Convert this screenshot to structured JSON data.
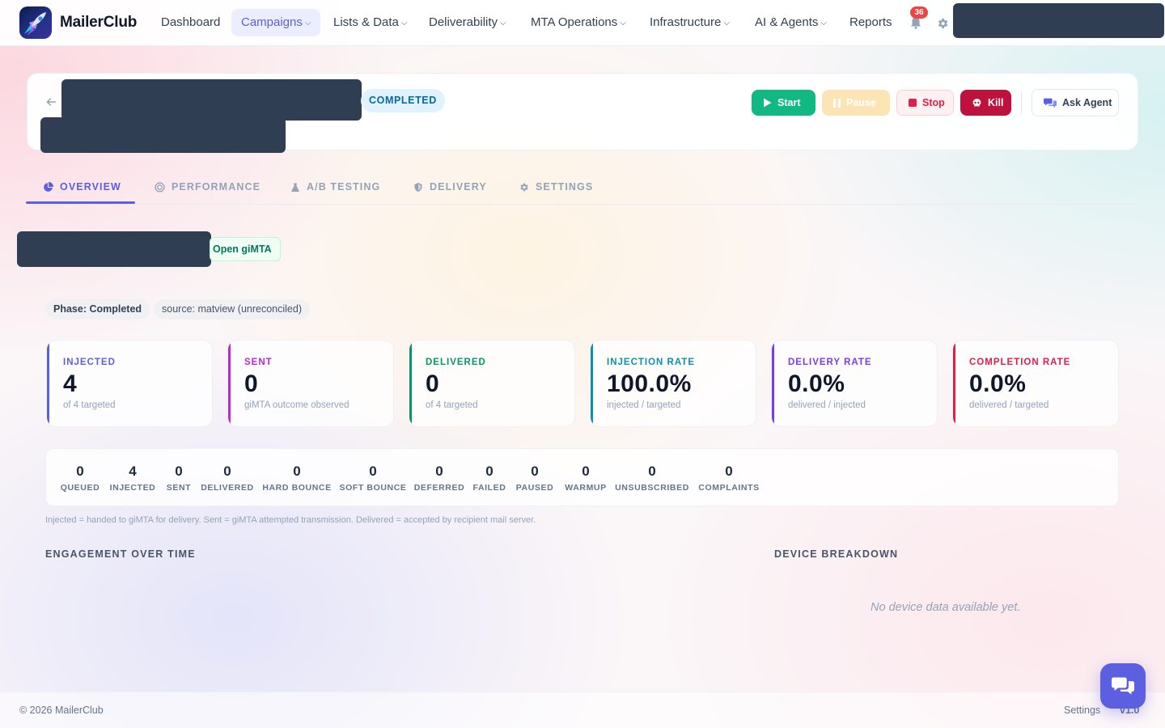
{
  "nav": {
    "brand": "MailerClub",
    "items": [
      {
        "label": "Dashboard",
        "dropdown": false
      },
      {
        "label": "Campaigns",
        "dropdown": true,
        "active": true
      },
      {
        "label": "Lists & Data",
        "dropdown": true
      },
      {
        "label": "Deliverability",
        "dropdown": true
      },
      {
        "label": "MTA Operations",
        "dropdown": true
      },
      {
        "label": "Infrastructure",
        "dropdown": true
      },
      {
        "label": "AI & Agents",
        "dropdown": true
      },
      {
        "label": "Reports",
        "dropdown": false
      }
    ],
    "chevron": "⌵",
    "notification_count": "36",
    "icons": {
      "bell": "bell-icon",
      "settings": "gear-icon"
    }
  },
  "header": {
    "status": "COMPLETED",
    "buttons": {
      "start": "Start",
      "pause": "Pause",
      "stop": "Stop",
      "kill": "Kill",
      "ask_agent": "Ask Agent"
    }
  },
  "tabs": [
    {
      "label": "OVERVIEW",
      "icon": "pie-chart-icon",
      "active": true
    },
    {
      "label": "PERFORMANCE",
      "icon": "target-icon"
    },
    {
      "label": "A/B TESTING",
      "icon": "flask-icon"
    },
    {
      "label": "DELIVERY",
      "icon": "shield-icon"
    },
    {
      "label": "SETTINGS",
      "icon": "gear-icon"
    }
  ],
  "gimta": {
    "open_label": "Open giMTA"
  },
  "chips": {
    "phase": "Phase: Completed",
    "source": "source: matview (unreconciled)"
  },
  "stats": [
    {
      "label": "INJECTED",
      "value": "4",
      "sub": "of 4 targeted",
      "color": "#5b5fe0"
    },
    {
      "label": "SENT",
      "value": "0",
      "sub": "giMTA outcome observed",
      "color": "#c026d3"
    },
    {
      "label": "DELIVERED",
      "value": "0",
      "sub": "of 4 targeted",
      "color": "#059669"
    },
    {
      "label": "INJECTION RATE",
      "value": "100.0%",
      "sub": "injected / targeted",
      "color": "#0891b2"
    },
    {
      "label": "DELIVERY RATE",
      "value": "0.0%",
      "sub": "delivered / injected",
      "color": "#7c3aed"
    },
    {
      "label": "COMPLETION RATE",
      "value": "0.0%",
      "sub": "delivered / targeted",
      "color": "#e11d48"
    }
  ],
  "counts": [
    {
      "value": "0",
      "label": "QUEUED"
    },
    {
      "value": "4",
      "label": "INJECTED"
    },
    {
      "value": "0",
      "label": "SENT"
    },
    {
      "value": "0",
      "label": "DELIVERED"
    },
    {
      "value": "0",
      "label": "HARD BOUNCE"
    },
    {
      "value": "0",
      "label": "SOFT BOUNCE"
    },
    {
      "value": "0",
      "label": "DEFERRED"
    },
    {
      "value": "0",
      "label": "FAILED"
    },
    {
      "value": "0",
      "label": "PAUSED"
    },
    {
      "value": "0",
      "label": "WARMUP"
    },
    {
      "value": "0",
      "label": "UNSUBSCRIBED"
    },
    {
      "value": "0",
      "label": "COMPLAINTS"
    }
  ],
  "explain": "Injected = handed to giMTA for delivery. Sent = giMTA attempted transmission. Delivered = accepted by recipient mail server.",
  "sections": {
    "engagement": "ENGAGEMENT OVER TIME",
    "device": "DEVICE BREAKDOWN",
    "device_empty": "No device data available yet."
  },
  "footer": {
    "copyright": "© 2026 MailerClub",
    "settings": "Settings",
    "version": "v1.0"
  }
}
